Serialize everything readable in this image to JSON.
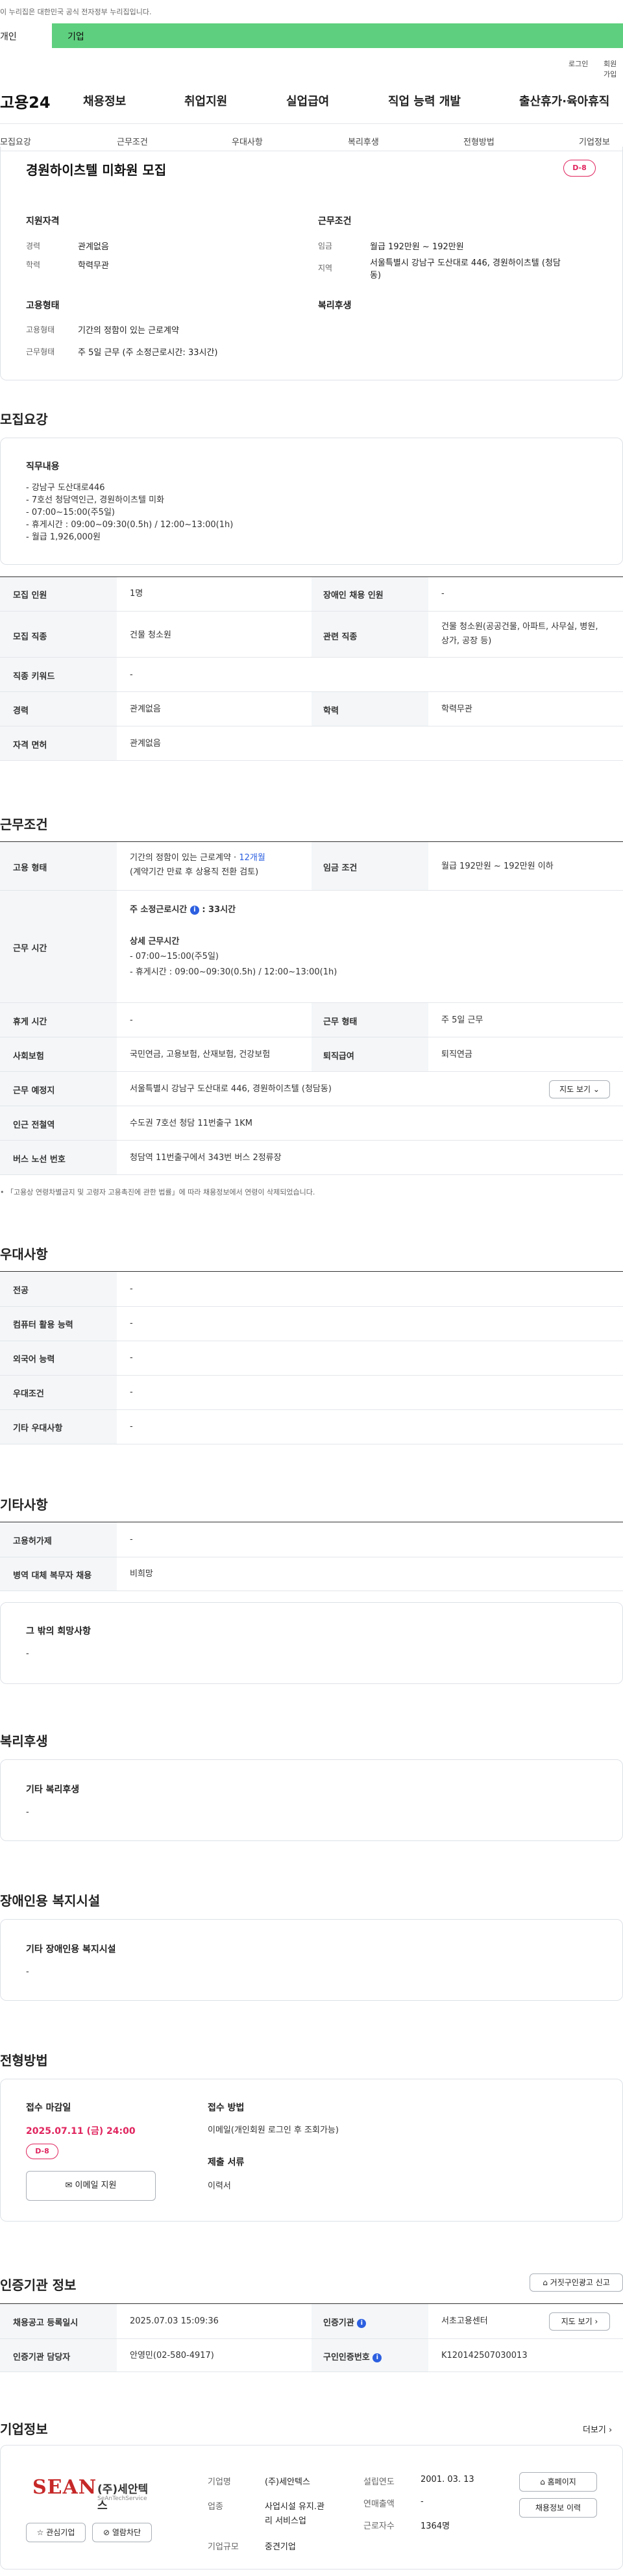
{
  "notice": "이 누리집은 대한민국 공식 전자정부 누리집입니다.",
  "usertabs": [
    "개인",
    "기업"
  ],
  "toplinks": [
    "로그인",
    "회원가입"
  ],
  "logo": "고용24",
  "gnb": [
    "채용정보",
    "취업지원",
    "실업급여",
    "직업 능력 개발",
    "출산휴가·육아휴직"
  ],
  "subnav": [
    "모집요강",
    "근무조건",
    "우대사항",
    "복리후생",
    "전형방법",
    "기업정보"
  ],
  "summary": {
    "title": "경원하이츠텔 미화원 모집",
    "dday": "D-8",
    "h_qual": "지원자격",
    "h_cond": "근무조건",
    "h_emp": "고용형태",
    "h_welfare": "복리후생",
    "qual": [
      {
        "k": "경력",
        "v": "관계없음"
      },
      {
        "k": "학력",
        "v": "학력무관"
      }
    ],
    "cond": [
      {
        "k": "임금",
        "v": "월급 192만원 ~ 192만원"
      },
      {
        "k": "지역",
        "v1": "서울특별시 강남구 도산대로 446, 경원하이츠텔 (청담",
        "v2": "동)"
      }
    ],
    "emp": [
      {
        "k": "고용형태",
        "v": "기간의 정함이 있는 근로계약"
      },
      {
        "k": "근무형태",
        "v": "주 5일 근무 (주 소정근로시간: 33시간)"
      }
    ]
  },
  "recruit": {
    "heading": "모집요강",
    "duty_title": "직무내용",
    "duty_lines": [
      "- 강남구 도산대로446",
      "- 7호선 청담역인근, 경원하이츠텔 미화",
      "- 07:00~15:00(주5일)",
      "- 휴게시간 : 09:00~09:30(0.5h) / 12:00~13:00(1h)",
      "- 월급 1,926,000원"
    ],
    "t_count_l": "모집 인원",
    "t_count_v": "1명",
    "t_dis_l": "장애인 채용 인원",
    "t_dis_v": "-",
    "t_job_l": "모집 직종",
    "t_job_v": "건물 청소원",
    "t_rel_l": "관련 직종",
    "t_rel_v1": "건물 청소원(공공건물, 아파트, 사무실, 병원,",
    "t_rel_v2": "상가, 공장 등)",
    "t_kw_l": "직종 키워드",
    "t_kw_v": "-",
    "t_car_l": "경력",
    "t_car_v": "관계없음",
    "t_edu_l": "학력",
    "t_edu_v": "학력무관",
    "t_lic_l": "자격 면허",
    "t_lic_v": "관계없음"
  },
  "work": {
    "heading": "근무조건",
    "emp_l": "고용 형태",
    "emp_v": "기간의 정함이 있는 근로계약 · ",
    "emp_months": "12개월",
    "emp_v2": "(계약기간 만료 후 상용직 전환 검토)",
    "wage_l": "임금 조건",
    "wage_v": "월급 192만원 ~ 192만원 이하",
    "hours_l": "근무 시간",
    "hours_weekly": "주 소정근로시간",
    "hours_weekly_v": ": 33시간",
    "hours_detail": "상세 근무시간",
    "hours_lines": [
      "- 07:00~15:00(주5일)",
      "- 휴게시간 : 09:00~09:30(0.5h) / 12:00~13:00(1h)"
    ],
    "break_l": "휴게 시간",
    "break_v": "-",
    "form_l": "근무 형태",
    "form_v": "주 5일 근무",
    "ins_l": "사회보험",
    "ins_v": "국민연금, 고용보험, 산재보험, 건강보험",
    "ret_l": "퇴직급여",
    "ret_v": "퇴직연금",
    "loc_l": "근무 예정지",
    "loc_v": "서울특별시 강남구 도산대로 446, 경원하이츠텔 (청담동)",
    "map_btn": "지도 보기",
    "sub_l": "인근 전철역",
    "sub_v": "수도권 7호선 청담 11번출구 1KM",
    "bus_l": "버스 노선 번호",
    "bus_v": "청담역 11번출구에서 343번 버스 2정류장",
    "note": "「고용상 연령차별금지 및 고령자 고용촉진에 관한 법률」에 따라 채용정보에서 연령이 삭제되었습니다."
  },
  "pref": {
    "heading": "우대사항",
    "rows": [
      {
        "k": "전공",
        "v": "-"
      },
      {
        "k": "컴퓨터 활용 능력",
        "v": "-"
      },
      {
        "k": "외국어 능력",
        "v": "-"
      },
      {
        "k": "우대조건",
        "v": "-"
      },
      {
        "k": "기타 우대사항",
        "v": "-"
      }
    ]
  },
  "etc": {
    "heading": "기타사항",
    "rows": [
      {
        "k": "고용허가제",
        "v": "-"
      },
      {
        "k": "병역 대체 복무자 채용",
        "v": "비희망"
      }
    ],
    "hope_title": "그 밖의 희망사항",
    "hope_v": "-"
  },
  "welfare": {
    "heading": "복리후생",
    "title": "기타 복리후생",
    "v": "-"
  },
  "facility": {
    "heading": "장애인용 복지시설",
    "title": "기타 장애인용 복지시설",
    "v": "-"
  },
  "apply": {
    "heading": "전형방법",
    "deadline_title": "접수 마감일",
    "deadline": "2025.07.11 (금) 24:00",
    "dday": "D-8",
    "email_btn": "이메일 지원",
    "method_title": "접수 방법",
    "method_v": "이메일(개인회원 로그인 후 조회가능)",
    "docs_title": "제출 서류",
    "docs_v": "이력서"
  },
  "agency": {
    "heading": "인증기관 정보",
    "report_btn": "거짓구인광고 신고",
    "reg_l": "채용공고 등록일시",
    "reg_v": "2025.07.03 15:09:36",
    "org_l": "인증기관",
    "org_v": "서초고용센터",
    "map_btn": "지도 보기",
    "mgr_l": "인증기관 담당자",
    "mgr_v": "안영민(02-580-4917)",
    "no_l": "구인인증번호",
    "no_v": "K120142507030013"
  },
  "company": {
    "heading": "기업정보",
    "more": "더보기",
    "logo_text": "(주)세안텍스",
    "logo_sub": "SEAN",
    "logo_en": "SeAnTechService",
    "fav_btn": "관심기업",
    "block_btn": "열람차단",
    "name_l": "기업명",
    "name_v": "(주)세안텍스",
    "ind_l": "업종",
    "ind_v1": "사업시설 유지.관",
    "ind_v2": "리 서비스업",
    "size_l": "기업규모",
    "size_v": "중견기업",
    "year_l": "설립연도",
    "year_v": "2001. 03. 13",
    "sales_l": "연매출액",
    "sales_v": "-",
    "emp_l": "근로자수",
    "emp_v": "1364명",
    "home_btn": "홈페이지",
    "jobs_btn": "채용정보 이력"
  }
}
